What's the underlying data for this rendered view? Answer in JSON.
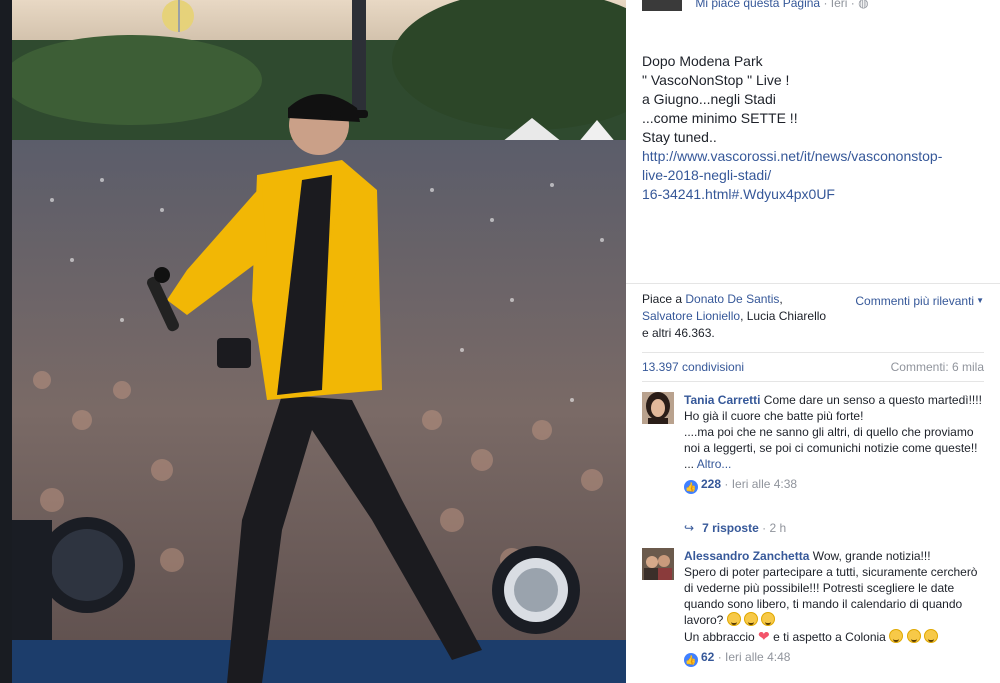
{
  "page_header": {
    "like_page": "Mi piace questa Pagina",
    "separator": "·",
    "time": "Ieri",
    "audience_icon": "globe-icon"
  },
  "post": {
    "lines": [
      "Dopo Modena Park",
      "\" VascoNonStop \" Live !",
      "a Giugno...negli Stadi",
      "...come minimo SETTE !!",
      "Stay tuned.."
    ],
    "url_lines": [
      "http://www.vascorossi.net/it/news/vascononstop-",
      "live-2018-negli-stadi/",
      "16-34241.html#.Wdyux4px0UF"
    ]
  },
  "reactions": {
    "prefix": "Piace a ",
    "name1": "Donato De Santis",
    "comma1": ",",
    "name2": "Salvatore Lioniello",
    "rest": ", Lucia Chiarello e altri 46.363.",
    "sort_label": "Commenti più rilevanti",
    "shares": "13.397 condivisioni",
    "comments_count": "Commenti: 6 mila"
  },
  "comments": [
    {
      "author": "Tania Carretti",
      "text1": " Come dare un senso a questo martedì!!!!",
      "text2": "Ho già il cuore che batte più forte!",
      "text3": "....ma poi che ne sanno gli altri, di quello che proviamo noi a leggerti, se poi ci comunichi notizie come queste!! ... ",
      "more": "Altro...",
      "likes": "228",
      "time": "Ieri alle 4:38",
      "replies": "7 risposte",
      "replies_time": "2 h"
    },
    {
      "author": "Alessandro Zanchetta",
      "text1": " Wow, grande notizia!!!",
      "text2": "Spero di poter partecipare a tutti, sicuramente cercherò di vederne più possibile!!! Potresti scegliere le date quando sono libero, ti mando il calendario di quando lavoro? ",
      "text3a": "Un abbraccio ",
      "text3b": " e ti aspetto a Colonia ",
      "likes": "62",
      "time": "Ieri alle 4:48"
    }
  ],
  "colors": {
    "link": "#365899",
    "muted": "#90949c",
    "like_blue": "#4080ff",
    "jacket": "#f2b705"
  }
}
